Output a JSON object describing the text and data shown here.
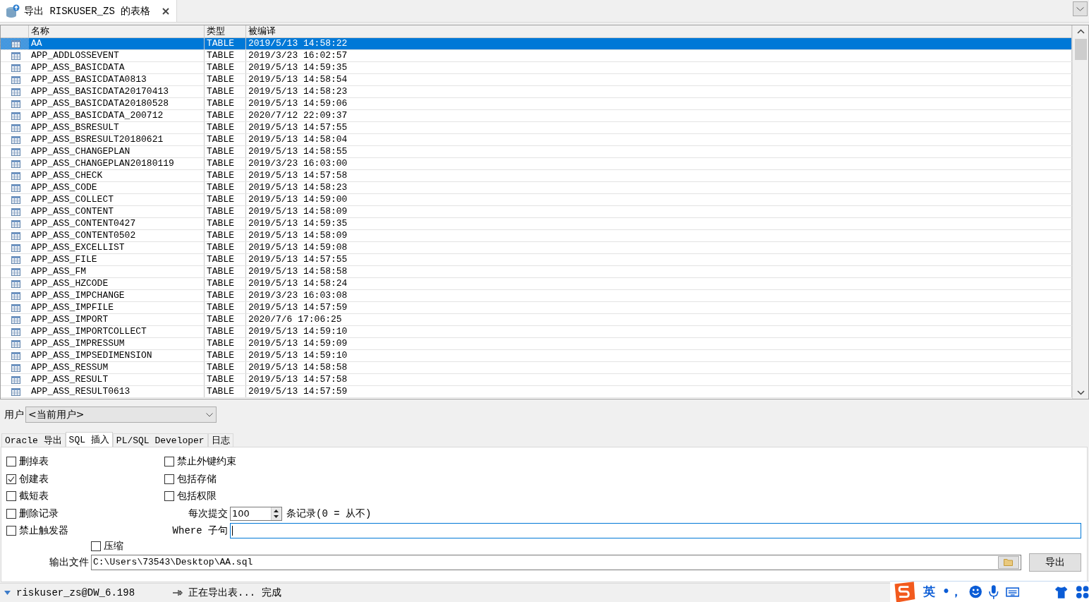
{
  "doc_tab": {
    "title": "导出 RISKUSER_ZS 的表格"
  },
  "table": {
    "columns": [
      "名称",
      "类型",
      "被编译"
    ],
    "rows": [
      {
        "name": "AA",
        "type": "TABLE",
        "compiled": "2019/5/13 14:58:22",
        "selected": true
      },
      {
        "name": "APP_ADDLOSSEVENT",
        "type": "TABLE",
        "compiled": "2019/3/23 16:02:57",
        "selected": false
      },
      {
        "name": "APP_ASS_BASICDATA",
        "type": "TABLE",
        "compiled": "2019/5/13 14:59:35",
        "selected": false
      },
      {
        "name": "APP_ASS_BASICDATA0813",
        "type": "TABLE",
        "compiled": "2019/5/13 14:58:54",
        "selected": false
      },
      {
        "name": "APP_ASS_BASICDATA20170413",
        "type": "TABLE",
        "compiled": "2019/5/13 14:58:23",
        "selected": false
      },
      {
        "name": "APP_ASS_BASICDATA20180528",
        "type": "TABLE",
        "compiled": "2019/5/13 14:59:06",
        "selected": false
      },
      {
        "name": "APP_ASS_BASICDATA_200712",
        "type": "TABLE",
        "compiled": "2020/7/12 22:09:37",
        "selected": false
      },
      {
        "name": "APP_ASS_BSRESULT",
        "type": "TABLE",
        "compiled": "2019/5/13 14:57:55",
        "selected": false
      },
      {
        "name": "APP_ASS_BSRESULT20180621",
        "type": "TABLE",
        "compiled": "2019/5/13 14:58:04",
        "selected": false
      },
      {
        "name": "APP_ASS_CHANGEPLAN",
        "type": "TABLE",
        "compiled": "2019/5/13 14:58:55",
        "selected": false
      },
      {
        "name": "APP_ASS_CHANGEPLAN20180119",
        "type": "TABLE",
        "compiled": "2019/3/23 16:03:00",
        "selected": false
      },
      {
        "name": "APP_ASS_CHECK",
        "type": "TABLE",
        "compiled": "2019/5/13 14:57:58",
        "selected": false
      },
      {
        "name": "APP_ASS_CODE",
        "type": "TABLE",
        "compiled": "2019/5/13 14:58:23",
        "selected": false
      },
      {
        "name": "APP_ASS_COLLECT",
        "type": "TABLE",
        "compiled": "2019/5/13 14:59:00",
        "selected": false
      },
      {
        "name": "APP_ASS_CONTENT",
        "type": "TABLE",
        "compiled": "2019/5/13 14:58:09",
        "selected": false
      },
      {
        "name": "APP_ASS_CONTENT0427",
        "type": "TABLE",
        "compiled": "2019/5/13 14:59:35",
        "selected": false
      },
      {
        "name": "APP_ASS_CONTENT0502",
        "type": "TABLE",
        "compiled": "2019/5/13 14:58:09",
        "selected": false
      },
      {
        "name": "APP_ASS_EXCELLIST",
        "type": "TABLE",
        "compiled": "2019/5/13 14:59:08",
        "selected": false
      },
      {
        "name": "APP_ASS_FILE",
        "type": "TABLE",
        "compiled": "2019/5/13 14:57:55",
        "selected": false
      },
      {
        "name": "APP_ASS_FM",
        "type": "TABLE",
        "compiled": "2019/5/13 14:58:58",
        "selected": false
      },
      {
        "name": "APP_ASS_HZCODE",
        "type": "TABLE",
        "compiled": "2019/5/13 14:58:24",
        "selected": false
      },
      {
        "name": "APP_ASS_IMPCHANGE",
        "type": "TABLE",
        "compiled": "2019/3/23 16:03:08",
        "selected": false
      },
      {
        "name": "APP_ASS_IMPFILE",
        "type": "TABLE",
        "compiled": "2019/5/13 14:57:59",
        "selected": false
      },
      {
        "name": "APP_ASS_IMPORT",
        "type": "TABLE",
        "compiled": "2020/7/6 17:06:25",
        "selected": false
      },
      {
        "name": "APP_ASS_IMPORTCOLLECT",
        "type": "TABLE",
        "compiled": "2019/5/13 14:59:10",
        "selected": false
      },
      {
        "name": "APP_ASS_IMPRESSUM",
        "type": "TABLE",
        "compiled": "2019/5/13 14:59:09",
        "selected": false
      },
      {
        "name": "APP_ASS_IMPSEDIMENSION",
        "type": "TABLE",
        "compiled": "2019/5/13 14:59:10",
        "selected": false
      },
      {
        "name": "APP_ASS_RESSUM",
        "type": "TABLE",
        "compiled": "2019/5/13 14:58:58",
        "selected": false
      },
      {
        "name": "APP_ASS_RESULT",
        "type": "TABLE",
        "compiled": "2019/5/13 14:57:58",
        "selected": false
      },
      {
        "name": "APP_ASS_RESULT0613",
        "type": "TABLE",
        "compiled": "2019/5/13 14:57:59",
        "selected": false
      }
    ]
  },
  "user": {
    "label": "用户",
    "value": "<当前用户>"
  },
  "tabs": [
    {
      "label": "Oracle 导出",
      "selected": false
    },
    {
      "label": "SQL 插入",
      "selected": true
    },
    {
      "label": "PL/SQL Developer",
      "selected": false
    },
    {
      "label": "日志",
      "selected": false
    }
  ],
  "options_left": [
    {
      "label": "删掉表",
      "checked": false
    },
    {
      "label": "创建表",
      "checked": true
    },
    {
      "label": "截短表",
      "checked": false
    },
    {
      "label": "删除记录",
      "checked": false
    },
    {
      "label": "禁止触发器",
      "checked": false
    }
  ],
  "options_right": [
    {
      "label": "禁止外键约束",
      "checked": false
    },
    {
      "label": "包括存储",
      "checked": false
    },
    {
      "label": "包括权限",
      "checked": false
    }
  ],
  "commit": {
    "label": "每次提交",
    "value": "100",
    "suffix": "条记录(0 = 从不)"
  },
  "where": {
    "label": "Where 子句"
  },
  "compress": {
    "label": "压缩",
    "checked": false
  },
  "output_file": {
    "label": "输出文件",
    "value": "C:\\Users\\73543\\Desktop\\AA.sql"
  },
  "export_button": "导出",
  "status_bar": {
    "connection": "riskuser_zs@DW_6.198",
    "message": "正在导出表... 完成"
  },
  "ime_bar": {
    "language": "英",
    "punctuation": "•，"
  }
}
